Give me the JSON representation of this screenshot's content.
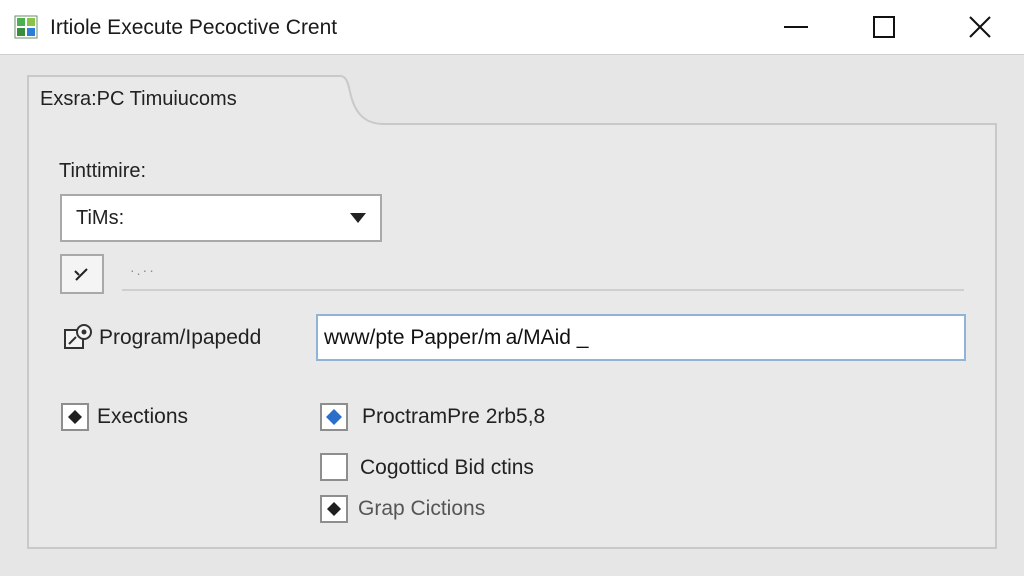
{
  "window": {
    "title": "Irtiole Execute Pecoctive Crent",
    "controls": {
      "minimize_icon": "minimize-icon",
      "maximize_icon": "maximize-icon",
      "close_icon": "close-icon"
    }
  },
  "tab": {
    "label": "Exsra:PC Timuiucoms"
  },
  "timing": {
    "label": "Tinttimire:",
    "select_value": "TiMs:",
    "arrow_icon": "chevron-down-icon"
  },
  "tool": {
    "icon": "wand-icon",
    "dots": "·.··"
  },
  "program": {
    "label": "Program/Ipapedd",
    "icon": "program-icon",
    "input_value": "www/pte Papper/m a/MAid _"
  },
  "options": {
    "executions": {
      "label": "Exections",
      "checked": true
    },
    "programpre": {
      "label": "ProctramPre 2rb5,8",
      "checked": true
    },
    "cogotticd": {
      "label": "Cogotticd Bid ctins",
      "checked": false
    },
    "group": {
      "label": "Grap Cictions",
      "checked": true
    }
  },
  "colors": {
    "accent": "#2a6fc9",
    "input_border": "#8fb4d8",
    "background": "#e6e6e6"
  }
}
